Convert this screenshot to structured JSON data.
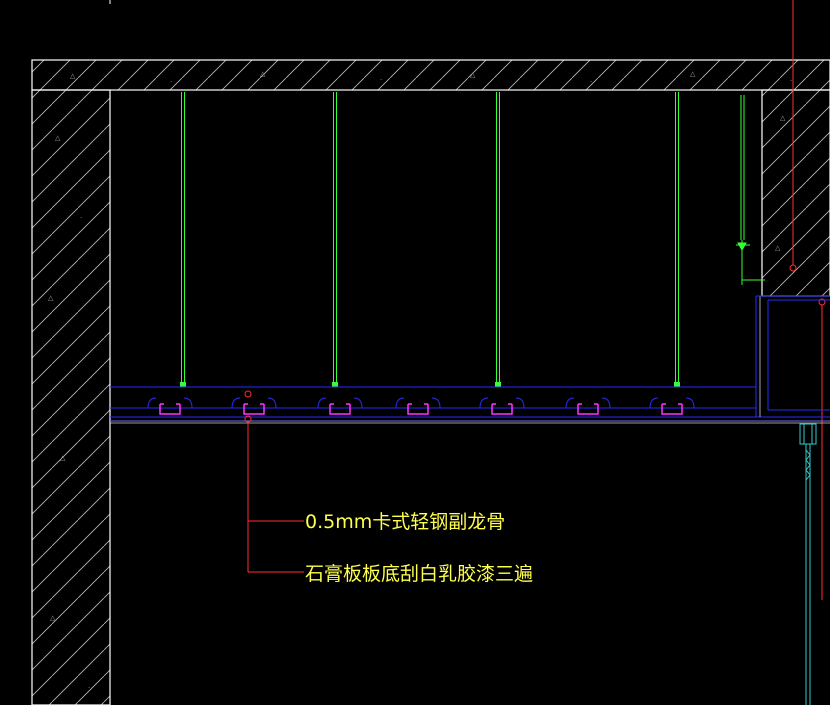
{
  "drawing": {
    "annotations": [
      {
        "text": "0.5mm卡式轻钢副龙骨"
      },
      {
        "text": "石膏板板底刮白乳胶漆三遍"
      }
    ],
    "hanger_count": 5,
    "clip_count": 7,
    "colors": {
      "background": "#000000",
      "concrete_outline": "#ffffff",
      "hatch": "#c8c8c8",
      "hanger_rod": "#33ff33",
      "ceiling_board": "#2a2aff",
      "clip": "#ff33ff",
      "leader_line": "#ff3030",
      "annotation_text": "#ffff4d",
      "wall_detail": "#33cccc"
    }
  }
}
